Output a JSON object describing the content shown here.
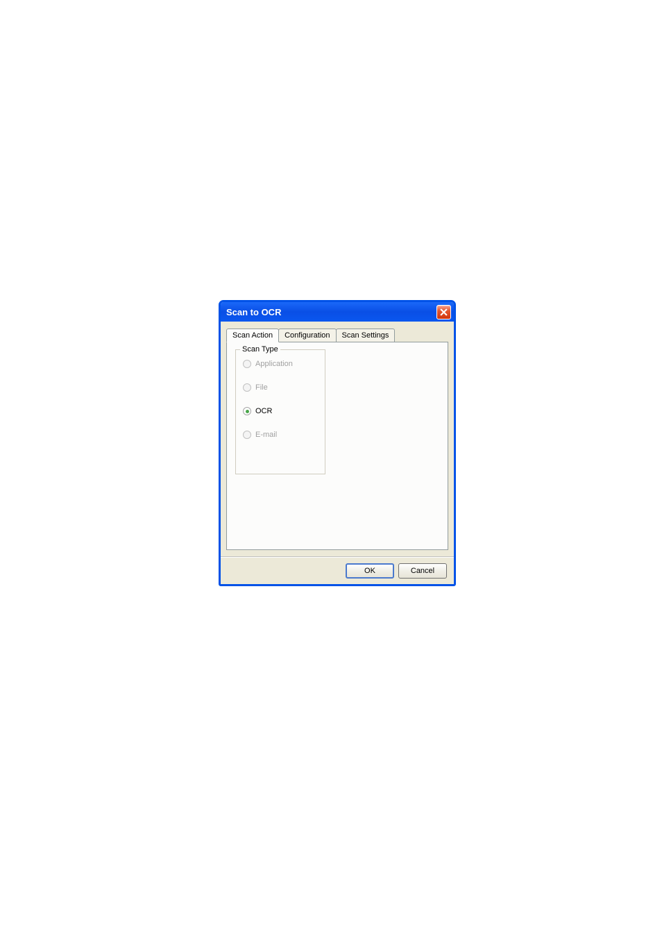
{
  "dialog": {
    "title": "Scan to OCR"
  },
  "tabs": {
    "scan_action": "Scan Action",
    "configuration": "Configuration",
    "scan_settings": "Scan Settings"
  },
  "fieldset": {
    "legend": "Scan Type"
  },
  "radios": {
    "application": "Application",
    "file": "File",
    "ocr": "OCR",
    "email": "E-mail"
  },
  "buttons": {
    "ok": "OK",
    "cancel": "Cancel"
  }
}
